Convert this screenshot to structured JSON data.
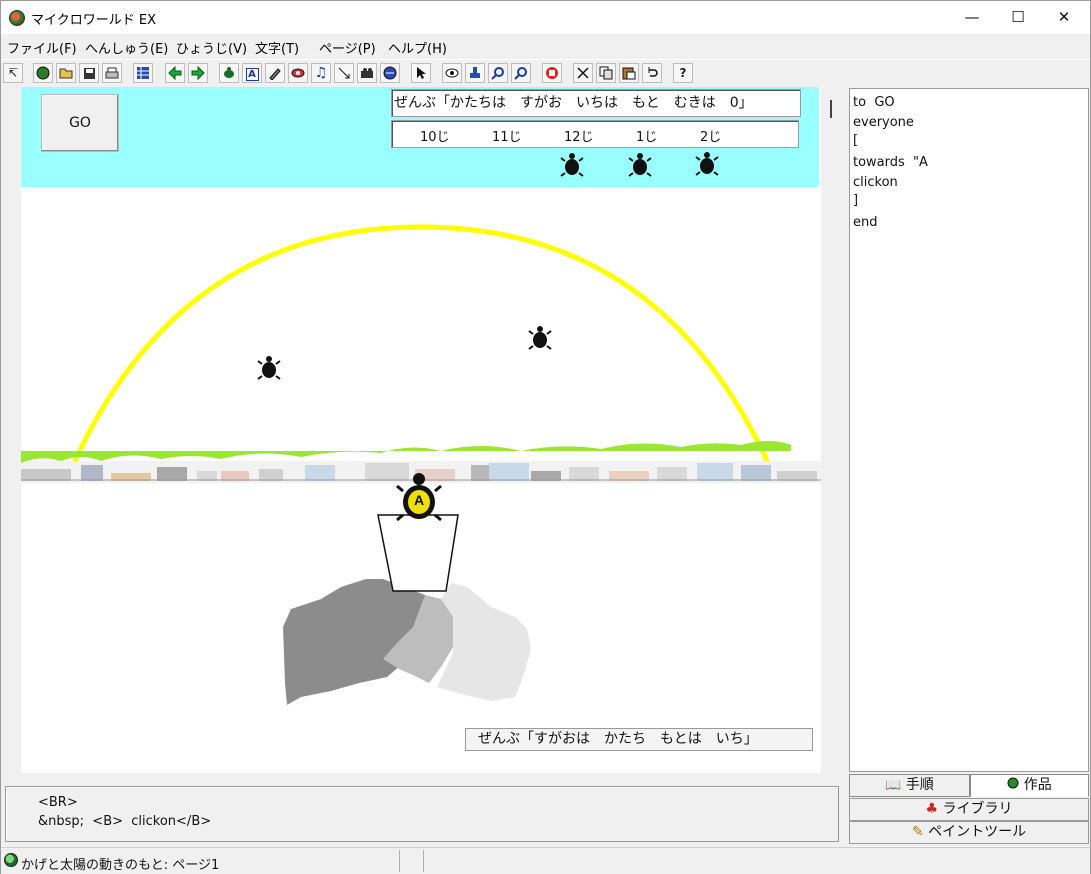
{
  "window": {
    "title": "マイクロワールド EX"
  },
  "window_controls": {
    "minimize": "—",
    "maximize": "☐",
    "close": "✕"
  },
  "menu": [
    "ファイル(F)",
    "へんしゅう(E)",
    "ひょうじ(V)",
    "文字(T)",
    "ページ(P)",
    "ヘルプ(H)"
  ],
  "toolbar_icons": [
    "pointer-small-icon",
    "globe-icon",
    "open-folder-icon",
    "save-icon",
    "print-icon",
    "grid-icon",
    "back-arrow-icon",
    "forward-arrow-icon",
    "turtle-hatch-icon",
    "text-box-icon",
    "paint-tool-icon",
    "eye-mask-icon",
    "music-icon",
    "shape-tool-icon",
    "camera-icon",
    "globe-media-icon",
    "select-arrow-icon",
    "eye-icon",
    "stamp-icon",
    "zoom-in-icon",
    "zoom-out-icon",
    "stop-hand-icon",
    "cut-icon",
    "copy-icon",
    "paste-icon",
    "undo-icon",
    "help-icon"
  ],
  "canvas": {
    "go_button": "GO",
    "top_textbox": "ぜんぶ「かたちは　すがお　いちは　もと　むきは　0」",
    "times": [
      "10じ",
      "11じ",
      "12じ",
      "1じ",
      "2じ"
    ],
    "hint_textbox": "ぜんぶ「すがおは　かたち　もとは　いち」",
    "turtle_label": "A"
  },
  "code_panel": {
    "lines": [
      "to  GO",
      "everyone",
      "[",
      "towards  \"A",
      "clickon",
      "]",
      "end"
    ]
  },
  "tabs": {
    "procedures": "手順",
    "project": "作品"
  },
  "side_buttons": {
    "library": "ライブラリ",
    "paint_tools": "ペイントツール"
  },
  "editor": {
    "lines": [
      "<BR>",
      "&nbsp;  <B>  clickon</B>"
    ]
  },
  "status": {
    "text": "かげと太陽の動きのもと: ページ1"
  },
  "colors": {
    "sky": "#99ffff",
    "sun_path": "#ffff00",
    "grass": "#99e633",
    "shadow_dark": "#8c8c8c",
    "shadow_mid": "#bdbdbd",
    "shadow_light": "#e6e6e6"
  }
}
